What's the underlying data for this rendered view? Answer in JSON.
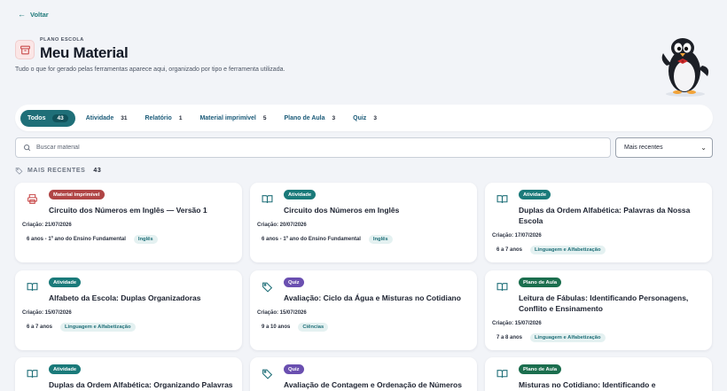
{
  "nav": {
    "back_label": "Voltar"
  },
  "header": {
    "eyebrow": "PLANO ESCOLA",
    "title": "Meu Material",
    "subtitle": "Tudo o que for gerado pelas ferramentas aparece aqui, organizado por tipo e ferramenta utilizada."
  },
  "tabs": [
    {
      "label": "Todos",
      "count": "43",
      "active": true
    },
    {
      "label": "Atividade",
      "count": "31"
    },
    {
      "label": "Relatório",
      "count": "1"
    },
    {
      "label": "Material imprimível",
      "count": "5"
    },
    {
      "label": "Plano de Aula",
      "count": "3"
    },
    {
      "label": "Quiz",
      "count": "3"
    }
  ],
  "search": {
    "placeholder": "Buscar material",
    "value": ""
  },
  "sort": {
    "selected": "Mais recentes"
  },
  "section": {
    "label": "MAIS RECENTES",
    "count": "43"
  },
  "colors": {
    "accent": "#1f6f78",
    "badge_atividade": "#1a7a7a",
    "badge_material": "#b04545",
    "badge_quiz": "#6a4fb0",
    "badge_plano": "#1b6e4e"
  },
  "cards": [
    {
      "icon": "printer-icon",
      "type": "Material imprimível",
      "title": "Circuito dos Números em Inglês — Versão 1",
      "created": "Criação: 21/07/2026",
      "age": "6 anos - 1º ano do Ensino Fundamental",
      "tag": "Inglês"
    },
    {
      "icon": "book-icon",
      "type": "Atividade",
      "title": "Circuito dos Números em Inglês",
      "created": "Criação: 20/07/2026",
      "age": "6 anos - 1º ano do Ensino Fundamental",
      "tag": "Inglês"
    },
    {
      "icon": "book-icon",
      "type": "Atividade",
      "title": "Duplas da Ordem Alfabética: Palavras da Nossa Escola",
      "created": "Criação: 17/07/2026",
      "age": "6 a 7 anos",
      "tag": "Linguagem e Alfabetização"
    },
    {
      "icon": "book-icon",
      "type": "Atividade",
      "title": "Alfabeto da Escola: Duplas Organizadoras",
      "created": "Criação: 15/07/2026",
      "age": "6 a 7 anos",
      "tag": "Linguagem e Alfabetização"
    },
    {
      "icon": "tag-icon",
      "type": "Quiz",
      "title": "Avaliação: Ciclo da Água e Misturas no Cotidiano",
      "created": "Criação: 15/07/2026",
      "age": "9 a 10 anos",
      "tag": "Ciências"
    },
    {
      "icon": "book-icon",
      "type": "Plano de Aula",
      "title": "Leitura de Fábulas: Identificando Personagens, Conflito e Ensinamento",
      "created": "Criação: 15/07/2026",
      "age": "7 a 8 anos",
      "tag": "Linguagem e Alfabetização"
    },
    {
      "icon": "book-icon",
      "type": "Atividade",
      "title": "Duplas da Ordem Alfabética: Organizando Palavras",
      "created": "",
      "age": "",
      "tag": ""
    },
    {
      "icon": "tag-icon",
      "type": "Quiz",
      "title": "Avaliação de Contagem e Ordenação de Números",
      "created": "",
      "age": "",
      "tag": ""
    },
    {
      "icon": "book-icon",
      "type": "Plano de Aula",
      "title": "Misturas no Cotidiano: Identificando e Classificando",
      "created": "",
      "age": "",
      "tag": ""
    }
  ]
}
